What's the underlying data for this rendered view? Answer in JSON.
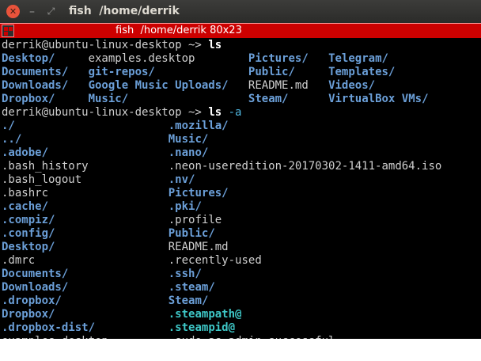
{
  "window": {
    "close_glyph": "✕",
    "min_glyph": "–",
    "max_glyph": "⤢",
    "title": "fish  /home/derrik"
  },
  "tab": {
    "title": "fish  /home/derrik 80x23"
  },
  "colors": {
    "dir": "#6b9fd8",
    "file": "#cfcfcf",
    "symlink": "#3ec7c7",
    "tab_bar": "#cc0000",
    "argument": "#4fb7e0"
  },
  "terminal": {
    "prompt": "derrik@ubuntu-linux-desktop ~>",
    "cmd1": "ls",
    "cmd2": "ls",
    "cmd2_arg": "-a",
    "ls_rows": [
      [
        "Desktop/",
        "examples.desktop",
        "Pictures/",
        "Telegram/"
      ],
      [
        "Documents/",
        "git-repos/",
        "Public/",
        "Templates/"
      ],
      [
        "Downloads/",
        "Google Music Uploads/",
        "README.md",
        "Videos/"
      ],
      [
        "Dropbox/",
        "Music/",
        "Steam/",
        "VirtualBox VMs/"
      ]
    ],
    "ls_a_left": [
      "./",
      "../",
      ".adobe/",
      ".bash_history",
      ".bash_logout",
      ".bashrc",
      ".cache/",
      ".compiz/",
      ".config/",
      "Desktop/",
      ".dmrc",
      "Documents/",
      "Downloads/",
      ".dropbox/",
      "Dropbox/",
      ".dropbox-dist/",
      "examples.desktop"
    ],
    "ls_a_right": [
      ".mozilla/",
      "Music/",
      ".nano/",
      ".neon-useredition-20170302-1411-amd64.iso",
      ".nv/",
      "Pictures/",
      ".pki/",
      ".profile",
      "Public/",
      "README.md",
      ".recently-used",
      ".ssh/",
      ".steam/",
      "Steam/",
      ".steampath@",
      ".steampid@",
      ".sudo_as_admin_successful"
    ]
  }
}
